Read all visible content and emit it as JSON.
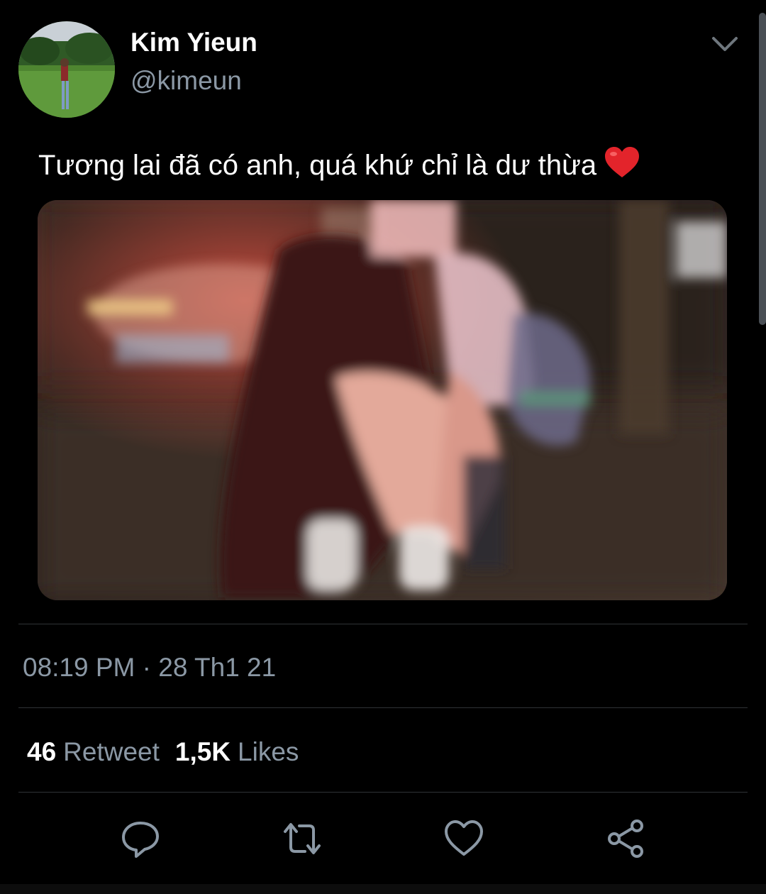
{
  "author": {
    "name": "Kim Yieun",
    "handle": "@kimeun",
    "avatar_icon": "profile-photo"
  },
  "tweet": {
    "text": "Tương lai đã có anh, quá khứ chỉ là dư thừa",
    "emoji_icon": "red-heart-emoji",
    "media_icon": "blurry-night-street-photo"
  },
  "meta": {
    "timestamp": "08:19 PM · 28 Th1 21"
  },
  "stats": {
    "retweets_count": "46",
    "retweets_label": "Retweet",
    "likes_count": "1,5K",
    "likes_label": "Likes"
  },
  "actions": [
    "reply-icon",
    "retweet-icon",
    "like-icon",
    "share-icon"
  ],
  "colors": {
    "background": "#000000",
    "primary_text": "#ffffff",
    "secondary_text": "#8b98a5",
    "divider": "#2f3336",
    "heart": "#e0245e"
  }
}
